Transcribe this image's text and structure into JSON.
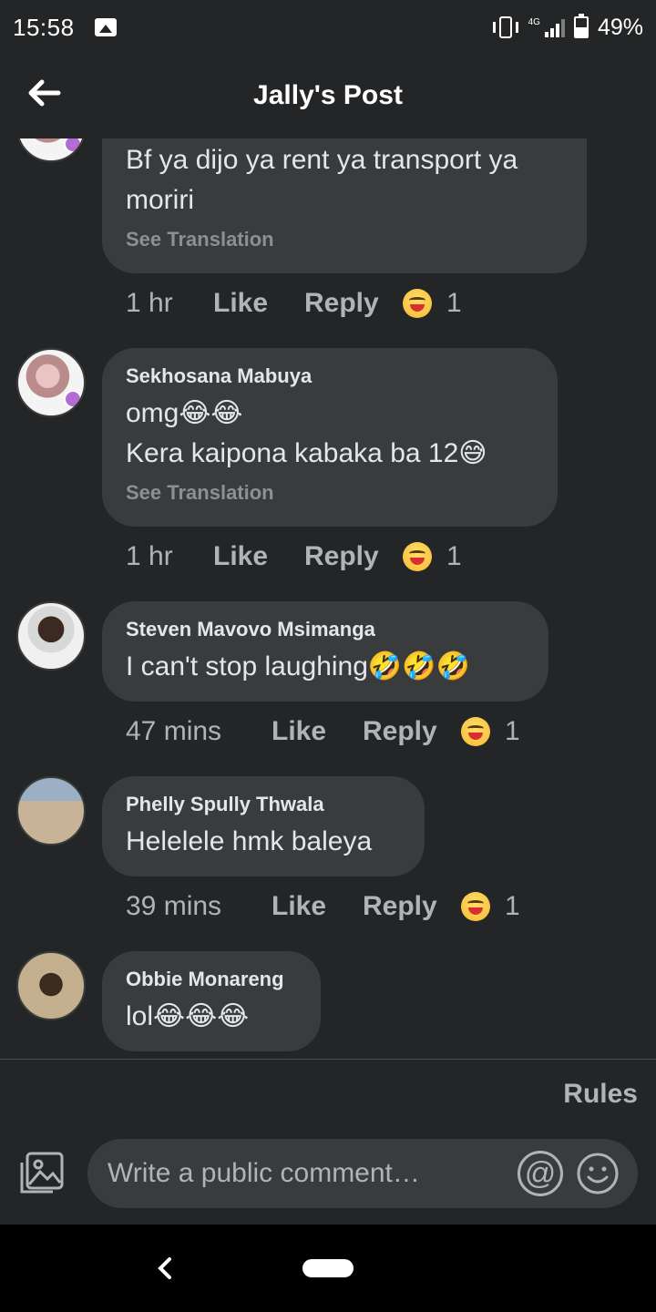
{
  "status_bar": {
    "time": "15:58",
    "network": "4G",
    "battery": "49%"
  },
  "header": {
    "title": "Jally's Post"
  },
  "comments": [
    {
      "name": "",
      "text": "Bf ya dijo ya rent ya transport ya\nmoriri",
      "see_translation": "See Translation",
      "time": "1 hr",
      "like": "Like",
      "reply": "Reply",
      "reaction_count": "1"
    },
    {
      "name": "Sekhosana Mabuya",
      "text": "omg😂😂\nKera kaipona kabaka ba 12😅",
      "see_translation": "See Translation",
      "time": "1 hr",
      "like": "Like",
      "reply": "Reply",
      "reaction_count": "1"
    },
    {
      "name": "Steven Mavovo Msimanga",
      "text": "I can't stop laughing🤣🤣🤣",
      "time": "47 mins",
      "like": "Like",
      "reply": "Reply",
      "reaction_count": "1"
    },
    {
      "name": "Phelly Spully Thwala",
      "text": "Helelele hmk baleya",
      "time": "39 mins",
      "like": "Like",
      "reply": "Reply",
      "reaction_count": "1"
    },
    {
      "name": "Obbie Monareng",
      "text": "lol😂😂😂"
    }
  ],
  "rules_label": "Rules",
  "composer": {
    "placeholder": "Write a public comment…"
  },
  "icons": {
    "back": "arrow-left-icon",
    "gallery": "photo-icon",
    "mention": "at-icon",
    "emoji": "smiley-icon",
    "reaction": "laughing-emoji-icon",
    "nav_back": "chevron-left-icon",
    "home": "home-pill-icon"
  },
  "colors": {
    "background": "#242526",
    "bubble": "#3a3b3c",
    "text": "#e4e6eb",
    "muted": "#b0b3b8"
  }
}
